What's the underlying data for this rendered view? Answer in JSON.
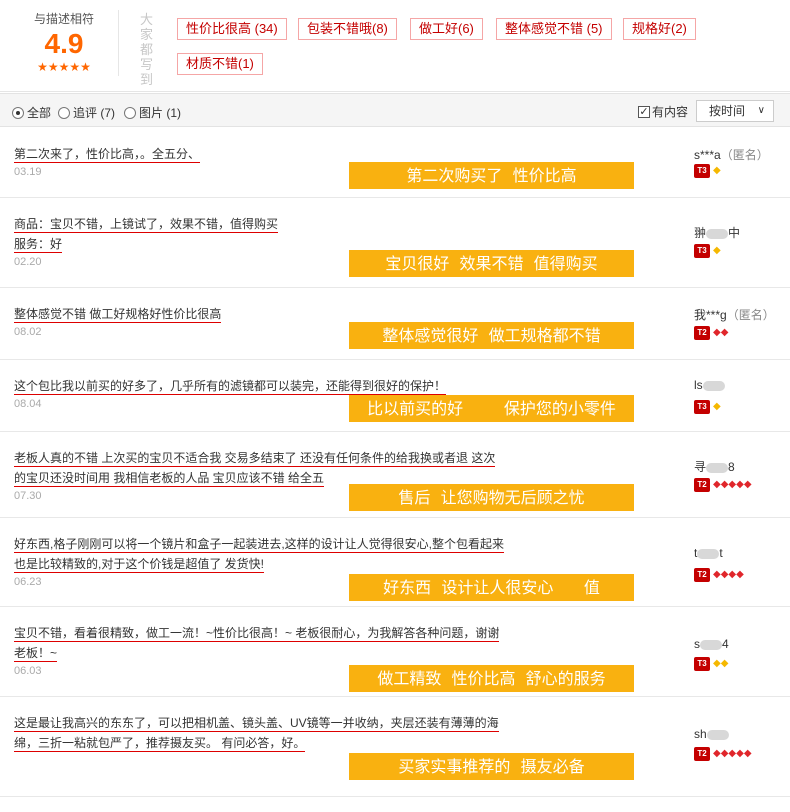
{
  "summary": {
    "title": "与描述相符",
    "score": "4.9",
    "stars": "★★★★★",
    "vertical_label": "大家都写到",
    "tags": [
      "性价比很高 (34)",
      "包装不错哦(8)",
      "做工好(6)",
      "整体感觉不错 (5)",
      "规格好(2)",
      "材质不错(1)"
    ]
  },
  "filters": {
    "all": "全部",
    "followup": "追评 (7)",
    "pictures": "图片 (1)",
    "has_content": "有内容",
    "sort": "按时间",
    "sort_chevron": "∨"
  },
  "icons": {
    "vip_label": "T3",
    "vip_label_2": "T2",
    "yellow_gem": "◆",
    "red_gem": "◆"
  },
  "reviews": [
    {
      "lines": [
        "第二次来了，性价比高，。全五分、"
      ],
      "date": "03.19",
      "banner": "第二次购买了  性价比高",
      "user": "s***a",
      "anon": "（匿名）",
      "vip": "T3",
      "gems": "yellow1"
    },
    {
      "lines": [
        "商品：宝贝不错，上镜试了，效果不错，值得购买",
        "服务：好"
      ],
      "date": "02.20",
      "banner": "宝贝很好  效果不错  值得购买",
      "user": "翀",
      "user_tail": "中",
      "vip": "T3",
      "gems": "yellow1"
    },
    {
      "lines": [
        "整体感觉不错 做工好规格好性价比很高"
      ],
      "date": "08.02",
      "banner": "整体感觉很好  做工规格都不错",
      "user": "我***g",
      "anon": "（匿名）",
      "vip": "T2",
      "gems": "red2"
    },
    {
      "lines": [
        "这个包比我以前买的好多了，几乎所有的滤镜都可以装完，还能得到很好的保护！"
      ],
      "date": "08.04",
      "banner": "比以前买的好        保护您的小零件",
      "user": "ls",
      "vip": "T3",
      "gems": "yellow1"
    },
    {
      "lines": [
        "老板人真的不错 上次买的宝贝不适合我 交易多结束了 还没有任何条件的给我换或者退 这次",
        "的宝贝还没时间用 我相信老板的人品 宝贝应该不错 给全五"
      ],
      "date": "07.30",
      "banner": "售后  让您购物无后顾之忧",
      "user": "寻",
      "user_tail": "8",
      "vip": "T2",
      "gems": "red5"
    },
    {
      "lines": [
        "好东西,格子刚刚可以将一个镜片和盒子一起装进去,这样的设计让人觉得很安心,整个包看起来",
        "也是比较精致的,对于这个价钱是超值了 发货快!"
      ],
      "date": "06.23",
      "banner": "好东西  设计让人很安心      值",
      "user": "t",
      "user_tail": "t",
      "vip": "T2",
      "gems": "red4"
    },
    {
      "lines": [
        "宝贝不错，看着很精致，做工一流！~性价比很高！~ 老板很耐心，为我解答各种问题，谢谢",
        "老板！~"
      ],
      "date": "06.03",
      "banner": "做工精致  性价比高  舒心的服务",
      "user": "s",
      "user_tail": "4",
      "vip": "T3",
      "gems": "yellow2"
    },
    {
      "lines": [
        "这是最让我高兴的东东了，可以把相机盖、镜头盖、UV镜等一并收纳，夹层还装有薄薄的海",
        "绵，三折一粘就包严了，推荐摄友买。 有问必答，好。"
      ],
      "date": "",
      "banner": "买家实事推荐的  摄友必备",
      "user": "sh",
      "vip": "T2",
      "gems": "red5"
    }
  ]
}
